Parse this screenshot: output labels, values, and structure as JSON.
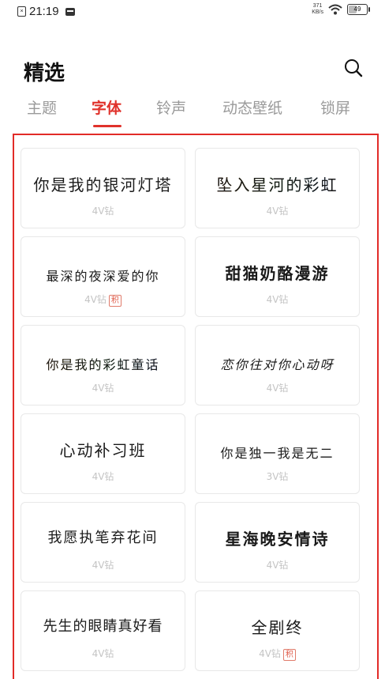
{
  "status": {
    "time": "21:19",
    "net_speed_top": "371",
    "net_speed_unit": "KB/s",
    "battery": "49"
  },
  "header": {
    "title": "精选"
  },
  "tabs": [
    {
      "label": "主题",
      "active": false
    },
    {
      "label": "字体",
      "active": true
    },
    {
      "label": "铃声",
      "active": false
    },
    {
      "label": "动态壁纸",
      "active": false
    },
    {
      "label": "锁屏",
      "active": false
    }
  ],
  "fonts": [
    {
      "name": "你是我的银河灯塔",
      "price": "4V钻",
      "badge": ""
    },
    {
      "name": "坠入星河的彩虹",
      "price": "4V钻",
      "badge": ""
    },
    {
      "name": "最深的夜深爱的你",
      "price": "4V钻",
      "badge": "积"
    },
    {
      "name": "甜猫奶酪漫游",
      "price": "4V钻",
      "badge": ""
    },
    {
      "name": "你是我的彩虹童话",
      "price": "4V钻",
      "badge": ""
    },
    {
      "name": "恋你往对你心动呀",
      "price": "4V钻",
      "badge": ""
    },
    {
      "name": "心动补习班",
      "price": "4V钻",
      "badge": ""
    },
    {
      "name": "你是独一我是无二",
      "price": "3V钻",
      "badge": ""
    },
    {
      "name": "我愿执笔弃花间",
      "price": "4V钻",
      "badge": ""
    },
    {
      "name": "星海晚安情诗",
      "price": "4V钻",
      "badge": ""
    },
    {
      "name": "先生的眼睛真好看",
      "price": "4V钻",
      "badge": ""
    },
    {
      "name": "全剧终",
      "price": "4V钻",
      "badge": "积"
    }
  ],
  "colors": {
    "accent": "#e0322b",
    "frame": "#e22b28"
  }
}
